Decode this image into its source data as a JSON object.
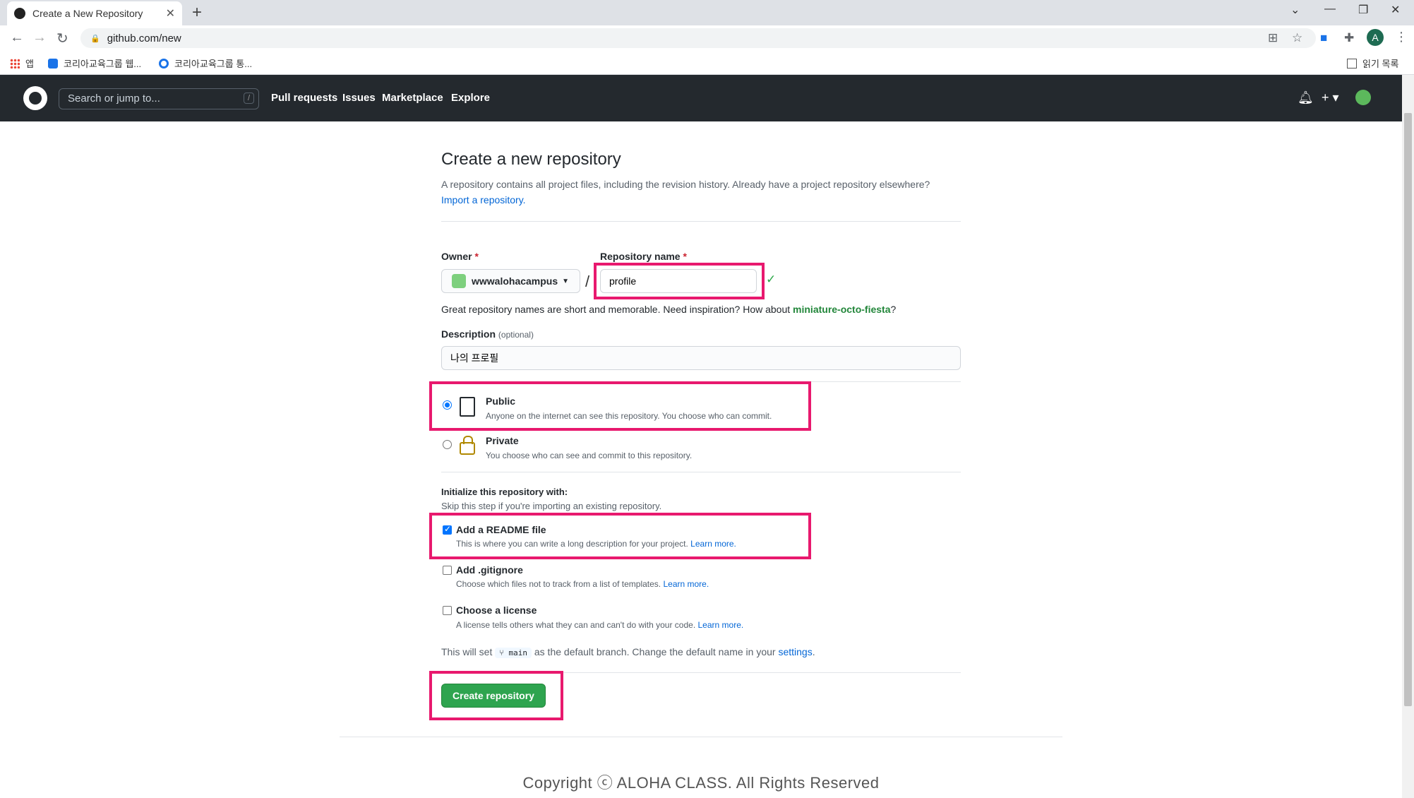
{
  "browser": {
    "tab_title": "Create a New Repository",
    "tab_close": "✕",
    "new_tab": "+",
    "url": "github.com/new",
    "profile_initial": "A",
    "bookmarks": [
      "앱",
      "코리아교육그룹 웹...",
      "코리아교육그룹 통..."
    ],
    "reading_list": "읽기 목록"
  },
  "gh_header": {
    "search_placeholder": "Search or jump to...",
    "search_shortcut": "/",
    "nav": [
      "Pull requests",
      "Issues",
      "Marketplace",
      "Explore"
    ]
  },
  "form": {
    "title": "Create a new repository",
    "subtitle": "A repository contains all project files, including the revision history. Already have a project repository elsewhere?",
    "import_link": "Import a repository.",
    "owner_label": "Owner",
    "required_mark": "*",
    "owner_value": "wwwalohacampus",
    "repo_label": "Repository name",
    "repo_value": "profile",
    "name_hint": "Great repository names are short and memorable. Need inspiration? How about",
    "name_suggestion": "miniature-octo-fiesta",
    "name_hint_end": "?",
    "desc_label": "Description",
    "desc_optional": "(optional)",
    "desc_value": "나의 프로필",
    "public_title": "Public",
    "public_desc": "Anyone on the internet can see this repository. You choose who can commit.",
    "private_title": "Private",
    "private_desc": "You choose who can see and commit to this repository.",
    "init_title": "Initialize this repository with:",
    "init_sub": "Skip this step if you're importing an existing repository.",
    "readme_title": "Add a README file",
    "readme_desc": "This is where you can write a long description for your project.",
    "gitignore_title": "Add .gitignore",
    "gitignore_desc": "Choose which files not to track from a list of templates.",
    "license_title": "Choose a license",
    "license_desc": "A license tells others what they can and can't do with your code.",
    "learn_more": "Learn more.",
    "branch_pre": "This will set",
    "branch_name": "main",
    "branch_post": "as the default branch. Change the default name in your",
    "settings_link": "settings",
    "create_button": "Create repository"
  },
  "footer": {
    "copyright": "Copyright ⓒ ALOHA CLASS. All Rights Reserved"
  },
  "colors": {
    "highlight": "#e8196e",
    "create_button": "#2ea44f",
    "link": "#0366d6",
    "suggestion": "#22863a"
  }
}
